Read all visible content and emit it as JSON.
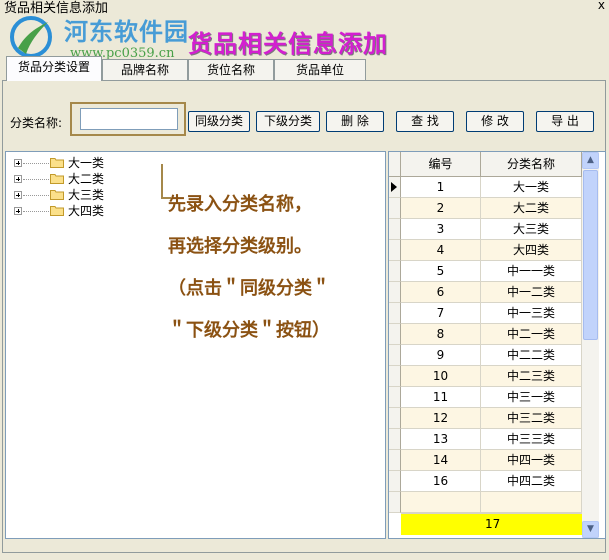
{
  "window": {
    "title": "货品相关信息添加",
    "close_label": "x"
  },
  "watermark": {
    "name": "河东软件园",
    "url": "www.pc0359.cn"
  },
  "banner": "货品相关信息添加",
  "tabs": [
    {
      "label": "货品分类设置"
    },
    {
      "label": "品牌名称"
    },
    {
      "label": "货位名称"
    },
    {
      "label": "货品单位"
    }
  ],
  "toolbar": {
    "category_label": "分类名称:",
    "category_value": "",
    "buttons": [
      "同级分类",
      "下级分类",
      "删 除",
      "查 找",
      "修 改",
      "导 出"
    ]
  },
  "tree": {
    "nodes": [
      "大一类",
      "大二类",
      "大三类",
      "大四类"
    ]
  },
  "annotation": {
    "lines": [
      "先录入分类名称，",
      "再选择分类级别。",
      "（点击＂同级分类＂",
      "＂下级分类＂按钮）"
    ]
  },
  "grid": {
    "columns": [
      "编号",
      "分类名称"
    ],
    "rows": [
      [
        "1",
        "大一类"
      ],
      [
        "2",
        "大二类"
      ],
      [
        "3",
        "大三类"
      ],
      [
        "4",
        "大四类"
      ],
      [
        "5",
        "中一一类"
      ],
      [
        "6",
        "中一二类"
      ],
      [
        "7",
        "中一三类"
      ],
      [
        "8",
        "中二一类"
      ],
      [
        "9",
        "中二二类"
      ],
      [
        "10",
        "中二三类"
      ],
      [
        "11",
        "中三一类"
      ],
      [
        "12",
        "中三二类"
      ],
      [
        "13",
        "中三三类"
      ],
      [
        "14",
        "中四一类"
      ],
      [
        "16",
        "中四二类"
      ],
      [
        "",
        ""
      ]
    ],
    "footer_value": "17"
  },
  "colors": {
    "banner": "#d31fd0",
    "annotation": "#8b5213",
    "highlight_box": "#a5884a",
    "footer_bg": "#ffff00",
    "row_alt": "#fdf6e3"
  },
  "icons": {
    "tree_expand": "plus-box-icon",
    "tree_node": "folder-icon",
    "row_pointer": "triangle-right-icon"
  }
}
